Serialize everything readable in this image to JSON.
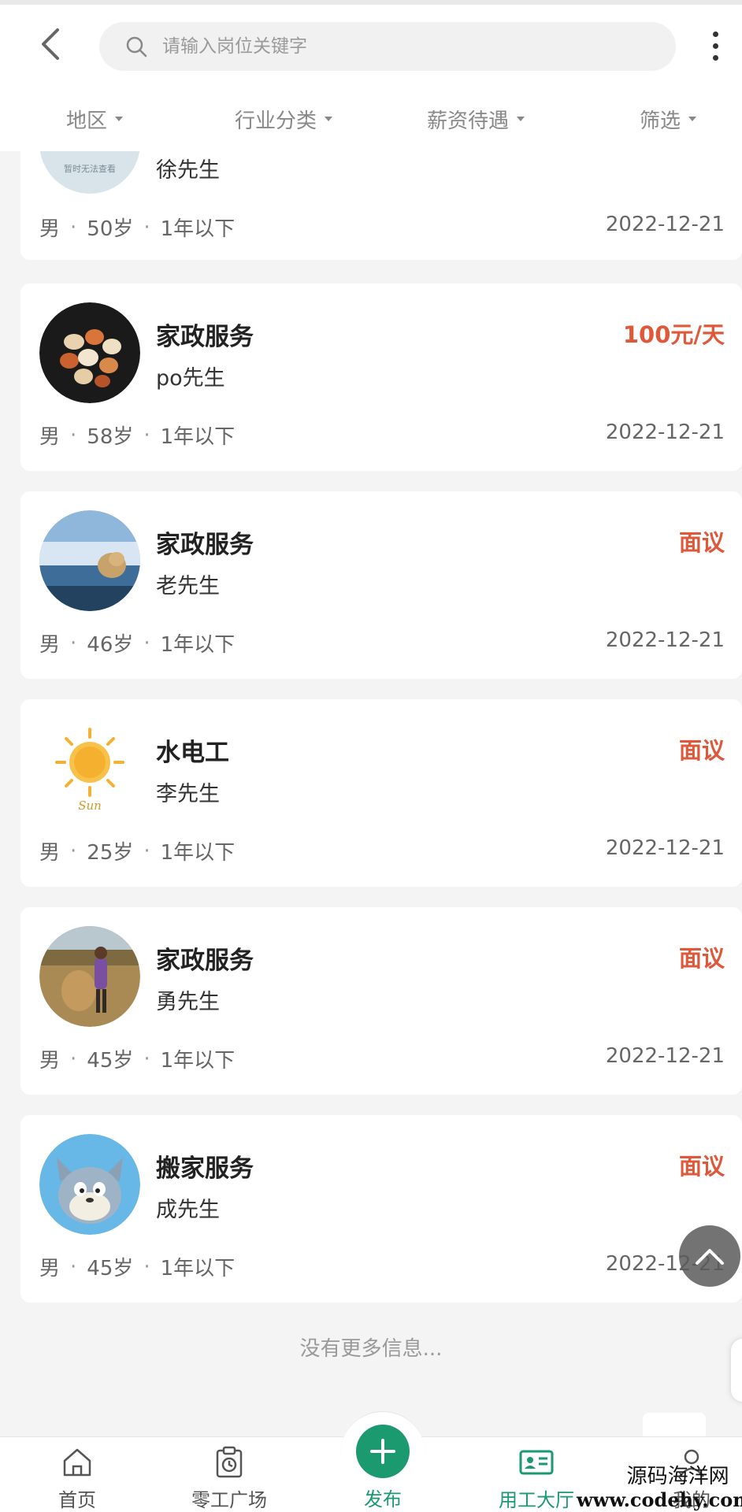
{
  "header": {
    "search_placeholder": "请输入岗位关键字",
    "filters": [
      "地区",
      "行业分类",
      "薪资待遇",
      "筛选"
    ]
  },
  "cards": [
    {
      "avatar": "unavailable-placeholder",
      "avatar_text": "暂时无法查看",
      "title": "",
      "contact": "徐先生",
      "salary": "",
      "gender": "男",
      "age": "50岁",
      "experience": "1年以下",
      "date": "2022-12-21"
    },
    {
      "avatar": "nuts-photo",
      "title": "家政服务",
      "contact": "po先生",
      "salary": "100元/天",
      "gender": "男",
      "age": "58岁",
      "experience": "1年以下",
      "date": "2022-12-21"
    },
    {
      "avatar": "dog-photo",
      "title": "家政服务",
      "contact": "老先生",
      "salary": "面议",
      "gender": "男",
      "age": "46岁",
      "experience": "1年以下",
      "date": "2022-12-21"
    },
    {
      "avatar": "sun-drawing",
      "avatar_text": "Sun",
      "title": "水电工",
      "contact": "李先生",
      "salary": "面议",
      "gender": "男",
      "age": "25岁",
      "experience": "1年以下",
      "date": "2022-12-21"
    },
    {
      "avatar": "person-field-photo",
      "title": "家政服务",
      "contact": "勇先生",
      "salary": "面议",
      "gender": "男",
      "age": "45岁",
      "experience": "1年以下",
      "date": "2022-12-21"
    },
    {
      "avatar": "cartoon-cat",
      "title": "搬家服务",
      "contact": "成先生",
      "salary": "面议",
      "gender": "男",
      "age": "45岁",
      "experience": "1年以下",
      "date": "2022-12-21"
    }
  ],
  "separator": "·",
  "footer_text": "没有更多信息...",
  "tabbar": {
    "home": "首页",
    "gig_square": "零工广场",
    "publish": "发布",
    "employer_hall": "用工大厅",
    "mine": "我的"
  },
  "watermark": {
    "line1": "源码海洋网",
    "line2": "www.codehy.com"
  },
  "colors": {
    "accent": "#1a9a6e",
    "salary": "#e0583a",
    "background": "#f4f4f4"
  }
}
